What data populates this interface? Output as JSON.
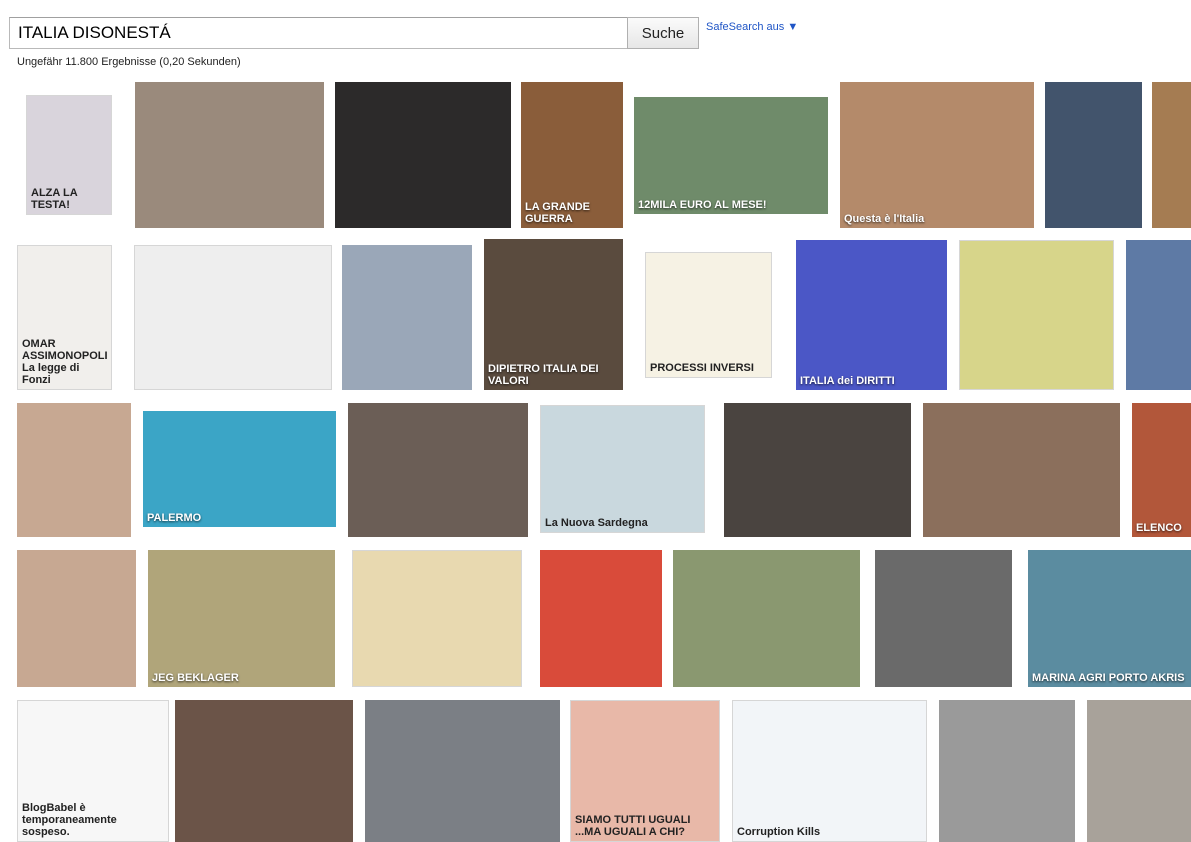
{
  "search": {
    "query": "ITALIA DISONESTÁ",
    "button_label": "Suche",
    "safesearch_label": "SafeSearch aus ▼"
  },
  "stats": "Ungefähr 11.800 Ergebnisse (0,20 Sekunden)",
  "rows": [
    [
      {
        "color": "#d9d4dc",
        "light": true,
        "caption": "ALZA LA TESTA!"
      },
      {
        "color": "#9a8a7c",
        "caption": ""
      },
      {
        "color": "#2c2a2a",
        "caption": ""
      },
      {
        "color": "#8a5d3a",
        "caption": "LA GRANDE GUERRA"
      },
      {
        "color": "#6f8b6a",
        "caption": "12MILA EURO AL MESE!"
      },
      {
        "color": "#b48a6a",
        "caption": "Questa è l'Italia"
      },
      {
        "color": "#42546c",
        "caption": ""
      },
      {
        "color": "#a57c52",
        "caption": ""
      }
    ],
    [
      {
        "color": "#f1efec",
        "light": true,
        "caption": "OMAR ASSIMONOPOLI La legge di Fonzi"
      },
      {
        "color": "#eeeeee",
        "light": true,
        "caption": ""
      },
      {
        "color": "#9aa7b8",
        "caption": ""
      },
      {
        "color": "#5a4b3e",
        "caption": "DIPIETRO ITALIA DEI VALORI"
      },
      {
        "color": "#f6f2e4",
        "light": true,
        "caption": "PROCESSI INVERSI"
      },
      {
        "color": "#4b57c6",
        "caption": "ITALIA dei DIRITTI"
      },
      {
        "color": "#d7d58a",
        "light": true,
        "caption": ""
      },
      {
        "color": "#5e7aa5",
        "caption": ""
      }
    ],
    [
      {
        "color": "#c7a892",
        "caption": ""
      },
      {
        "color": "#3ba5c6",
        "caption": "PALERMO"
      },
      {
        "color": "#6b5e56",
        "caption": ""
      },
      {
        "color": "#c9d8de",
        "light": true,
        "caption": "La Nuova Sardegna"
      },
      {
        "color": "#4a4440",
        "caption": ""
      },
      {
        "color": "#8b6f5c",
        "caption": ""
      },
      {
        "color": "#b2573a",
        "caption": "ELENCO"
      }
    ],
    [
      {
        "color": "#c7a892",
        "caption": ""
      },
      {
        "color": "#b0a57a",
        "caption": "JEG BEKLAGER"
      },
      {
        "color": "#e8d9b0",
        "light": true,
        "caption": ""
      },
      {
        "color": "#d94b3a",
        "caption": ""
      },
      {
        "color": "#8a9870",
        "caption": ""
      },
      {
        "color": "#6a6a6a",
        "caption": ""
      },
      {
        "color": "#5b8ca0",
        "caption": "MARINA AGRI PORTO AKRIS"
      }
    ],
    [
      {
        "color": "#f7f7f7",
        "light": true,
        "caption": "BlogBabel è temporaneamente sospeso."
      },
      {
        "color": "#6b5448",
        "caption": ""
      },
      {
        "color": "#7b7f85",
        "caption": ""
      },
      {
        "color": "#e8b8a8",
        "light": true,
        "caption": "SIAMO TUTTI UGUALI ...MA UGUALI A CHI?"
      },
      {
        "color": "#f2f5f8",
        "light": true,
        "caption": "Corruption Kills"
      },
      {
        "color": "#9a9a9a",
        "caption": ""
      },
      {
        "color": "#a8a29a",
        "caption": ""
      }
    ]
  ],
  "colors": {
    "link": "#1f55c6"
  }
}
